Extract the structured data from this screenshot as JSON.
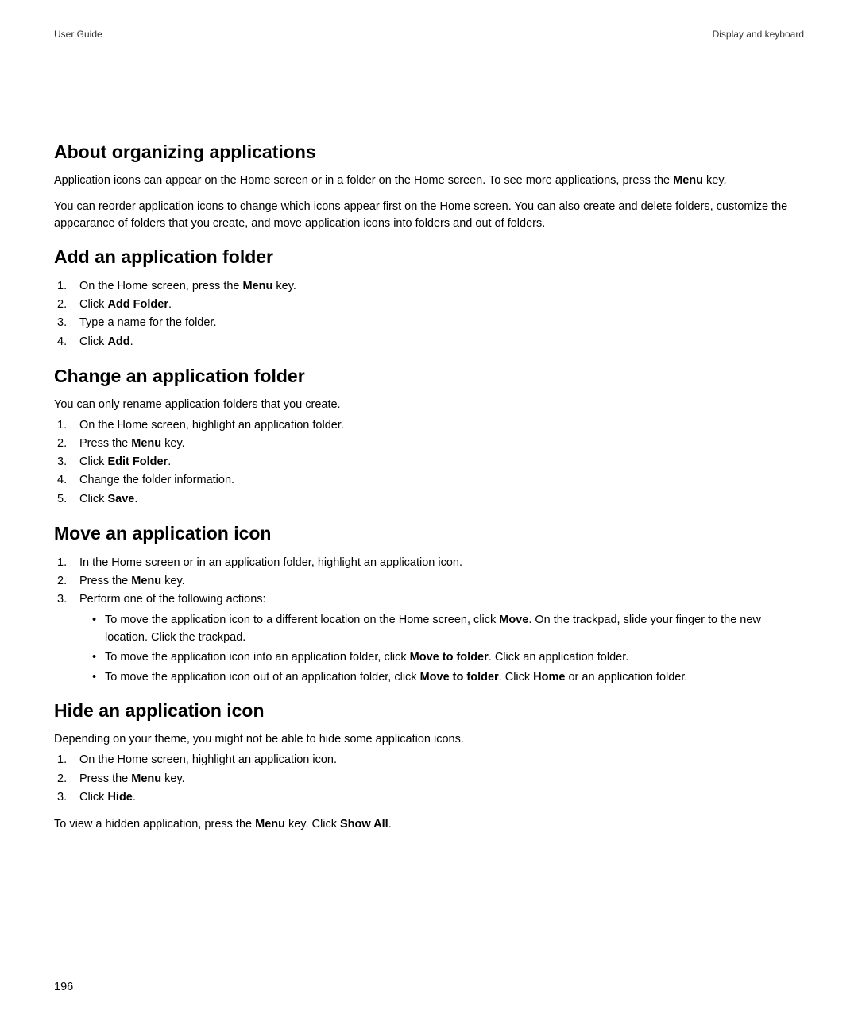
{
  "header": {
    "left": "User Guide",
    "right": "Display and keyboard"
  },
  "pageNumber": "196",
  "sections": {
    "about": {
      "title": "About organizing applications",
      "p1_a": "Application icons can appear on the Home screen or in a folder on the Home screen. To see more applications, press the ",
      "p1_b": "Menu",
      "p1_c": " key.",
      "p2": "You can reorder application icons to change which icons appear first on the Home screen. You can also create and delete folders, customize the appearance of folders that you create, and move application icons into folders and out of folders."
    },
    "add": {
      "title": "Add an application folder",
      "step1_a": "On the Home screen, press the ",
      "step1_b": "Menu",
      "step1_c": " key.",
      "step2_a": "Click ",
      "step2_b": "Add Folder",
      "step2_c": ".",
      "step3": "Type a name for the folder.",
      "step4_a": "Click ",
      "step4_b": "Add",
      "step4_c": "."
    },
    "change": {
      "title": "Change an application folder",
      "intro": "You can only rename application folders that you create.",
      "step1": "On the Home screen, highlight an application folder.",
      "step2_a": "Press the ",
      "step2_b": "Menu",
      "step2_c": " key.",
      "step3_a": "Click ",
      "step3_b": "Edit Folder",
      "step3_c": ".",
      "step4": "Change the folder information.",
      "step5_a": "Click ",
      "step5_b": "Save",
      "step5_c": "."
    },
    "move": {
      "title": "Move an application icon",
      "step1": "In the Home screen or in an application folder, highlight an application icon.",
      "step2_a": "Press the ",
      "step2_b": "Menu",
      "step2_c": " key.",
      "step3": "Perform one of the following actions:",
      "b1_a": "To move the application icon to a different location on the Home screen, click ",
      "b1_b": "Move",
      "b1_c": ". On the trackpad, slide your finger to the new location. Click the trackpad.",
      "b2_a": "To move the application icon into an application folder, click ",
      "b2_b": "Move to folder",
      "b2_c": ". Click an application folder.",
      "b3_a": "To move the application icon out of an application folder, click ",
      "b3_b": "Move to folder",
      "b3_c": ". Click ",
      "b3_d": "Home",
      "b3_e": " or an application folder."
    },
    "hide": {
      "title": "Hide an application icon",
      "intro": "Depending on your theme, you might not be able to hide some application icons.",
      "step1": "On the Home screen, highlight an application icon.",
      "step2_a": "Press the ",
      "step2_b": "Menu",
      "step2_c": " key.",
      "step3_a": "Click ",
      "step3_b": "Hide",
      "step3_c": ".",
      "closing_a": "To view a hidden application, press the ",
      "closing_b": "Menu",
      "closing_c": " key. Click ",
      "closing_d": "Show All",
      "closing_e": "."
    }
  }
}
